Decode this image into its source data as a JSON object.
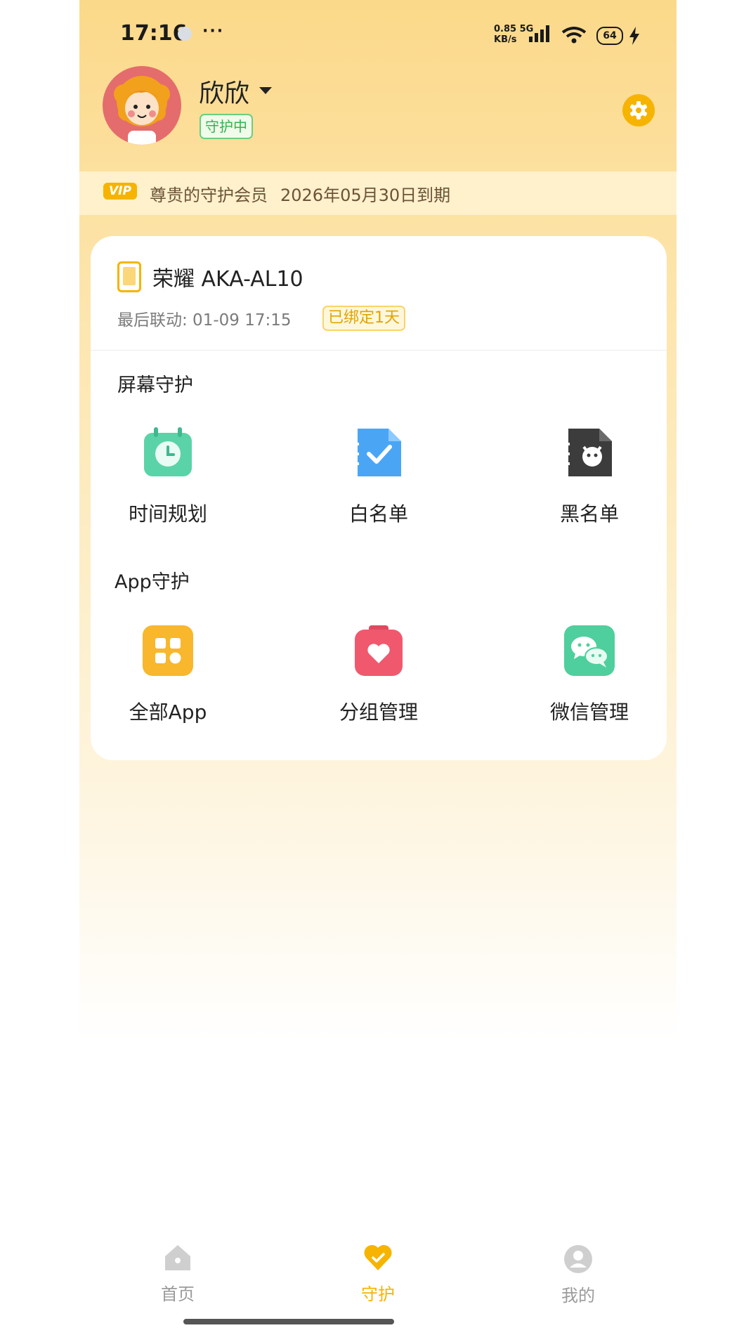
{
  "status_bar": {
    "time": "17:16",
    "more": "···",
    "net_speed_value": "0.85",
    "net_speed_unit": "KB/s",
    "network_type": "5G",
    "battery": "64"
  },
  "profile": {
    "name": "欣欣",
    "status_badge": "守护中"
  },
  "vip": {
    "tag": "VIP",
    "label": "尊贵的守护会员",
    "expiry": "2026年05月30日到期"
  },
  "device": {
    "name": "荣耀 AKA-AL10",
    "last_sync": "最后联动: 01-09 17:15",
    "bind_badge": "已绑定1天"
  },
  "screen_guard": {
    "title": "屏幕守护",
    "items": [
      {
        "label": "时间规划",
        "icon": "time-plan-icon"
      },
      {
        "label": "白名单",
        "icon": "whitelist-icon"
      },
      {
        "label": "黑名单",
        "icon": "blacklist-icon"
      }
    ]
  },
  "app_guard": {
    "title": "App守护",
    "items": [
      {
        "label": "全部App",
        "icon": "all-apps-icon"
      },
      {
        "label": "分组管理",
        "icon": "group-manage-icon"
      },
      {
        "label": "微信管理",
        "icon": "wechat-manage-icon"
      }
    ]
  },
  "bottom_nav": {
    "items": [
      {
        "label": "首页",
        "icon": "home-icon",
        "active": false
      },
      {
        "label": "守护",
        "icon": "heart-shield-icon",
        "active": true
      },
      {
        "label": "我的",
        "icon": "user-icon",
        "active": false
      }
    ]
  },
  "colors": {
    "accent": "#f6b400",
    "guard_green": "#33b352",
    "header_bg": "#fbd98a"
  }
}
